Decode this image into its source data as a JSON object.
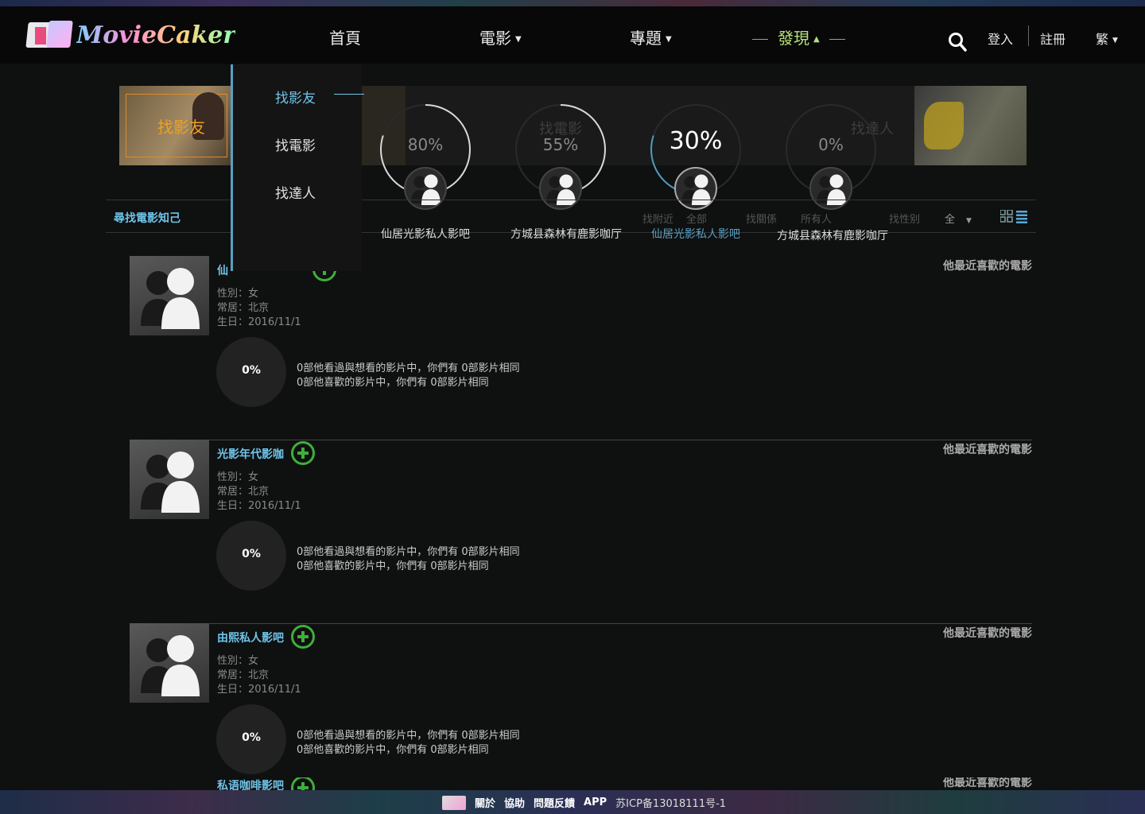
{
  "header": {
    "logo_text": "MovieCaker",
    "nav": [
      {
        "label": "首頁"
      },
      {
        "label": "電影"
      },
      {
        "label": "專題"
      },
      {
        "label": "發現"
      }
    ],
    "login": "登入",
    "register": "註冊",
    "language": "繁"
  },
  "dropdown": {
    "items": [
      {
        "label": "找影友"
      },
      {
        "label": "找電影"
      },
      {
        "label": "找達人"
      }
    ]
  },
  "hero": {
    "thumb_label": "找影友",
    "ghost_labels": [
      "找電影",
      "找達人"
    ]
  },
  "circles": [
    {
      "percent": "80%",
      "name": "仙居光影私人影吧",
      "value": 0.8
    },
    {
      "percent": "55%",
      "name": "方城县森林有鹿影咖厅",
      "value": 0.55
    },
    {
      "percent": "30%",
      "name": "仙居光影私人影吧",
      "value": 0.3
    },
    {
      "percent": "0%",
      "name": "方城县森林有鹿影咖厅",
      "value": 0
    }
  ],
  "filter": {
    "title": "尋找電影知己",
    "ghost": [
      "找附近",
      "全部",
      "找關係",
      "所有人",
      "找性别"
    ],
    "gender_value": "全"
  },
  "rows": [
    {
      "name": "仙",
      "gender": "性別：女",
      "city": "常居：北京",
      "birthday": "生日：2016/11/1",
      "match": "0%",
      "stat1": "0部他看過與想看的影片中，你們有 0部影片相同",
      "stat2": "0部他喜歡的影片中，你們有 0部影片相同",
      "fav": "他最近喜歡的電影"
    },
    {
      "name": "光影年代影咖",
      "gender": "性別：女",
      "city": "常居：北京",
      "birthday": "生日：2016/11/1",
      "match": "0%",
      "stat1": "0部他看過與想看的影片中，你們有 0部影片相同",
      "stat2": "0部他喜歡的影片中，你們有 0部影片相同",
      "fav": "他最近喜歡的電影"
    },
    {
      "name": "由熙私人影吧",
      "gender": "性別：女",
      "city": "常居：北京",
      "birthday": "生日：2016/11/1",
      "match": "0%",
      "stat1": "0部他看過與想看的影片中，你們有 0部影片相同",
      "stat2": "0部他喜歡的影片中，你們有 0部影片相同",
      "fav": "他最近喜歡的電影"
    },
    {
      "name": "私语咖啡影吧",
      "fav": "他最近喜歡的電影"
    }
  ],
  "footer": {
    "links": [
      "關於",
      "協助",
      "問題反饋",
      "APP"
    ],
    "icp": "苏ICP备13018111号-1"
  },
  "colors": {
    "accent_blue": "#6fc4ea",
    "nav_active_green": "#b6e07a",
    "add_green": "#3fae3a"
  }
}
